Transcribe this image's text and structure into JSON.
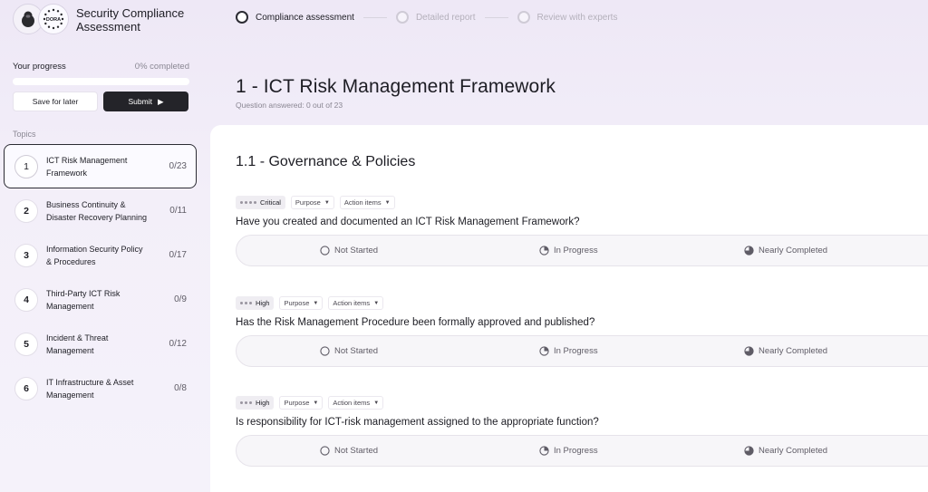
{
  "brand": {
    "title": "Security Compliance Assessment",
    "badge_text": "DORA"
  },
  "stepper": [
    {
      "label": "Compliance assessment",
      "active": true
    },
    {
      "label": "Detailed report",
      "active": false
    },
    {
      "label": "Review with experts",
      "active": false
    }
  ],
  "sidebar": {
    "progress_label": "Your progress",
    "progress_text": "0% completed",
    "progress_value": 0,
    "save_label": "Save for later",
    "submit_label": "Submit",
    "topics_label": "Topics",
    "topics": [
      {
        "num": "1",
        "name": "ICT Risk Management Framework",
        "count": "0/23"
      },
      {
        "num": "2",
        "name": "Business Continuity & Disaster Recovery Planning",
        "count": "0/11"
      },
      {
        "num": "3",
        "name": "Information Security Policy & Procedures",
        "count": "0/17"
      },
      {
        "num": "4",
        "name": "Third-Party ICT Risk Management",
        "count": "0/9"
      },
      {
        "num": "5",
        "name": "Incident & Threat Management",
        "count": "0/12"
      },
      {
        "num": "6",
        "name": "IT Infrastructure & Asset Management",
        "count": "0/8"
      }
    ]
  },
  "main": {
    "title": "1 - ICT Risk Management Framework",
    "subtitle": "Question answered: 0 out of 23",
    "section_title": "1.1 - Governance & Policies",
    "questions": [
      {
        "severity": "Critical",
        "purpose": "Purpose",
        "actions": "Action items",
        "text": "Have you created and documented an ICT Risk Management Framework?"
      },
      {
        "severity": "High",
        "purpose": "Purpose",
        "actions": "Action items",
        "text": "Has the Risk Management Procedure been formally approved and published?"
      },
      {
        "severity": "High",
        "purpose": "Purpose",
        "actions": "Action items",
        "text": "Is responsibility for ICT-risk management assigned to the appropriate function?"
      }
    ],
    "options": {
      "not_started": "Not Started",
      "in_progress": "In Progress",
      "nearly_completed": "Nearly Completed"
    }
  },
  "colors": {
    "accent_dark": "#242429",
    "background": "#eee8f6"
  }
}
